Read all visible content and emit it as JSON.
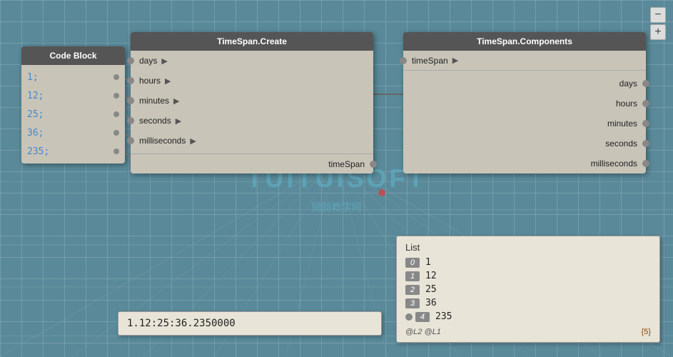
{
  "canvas": {
    "bg_color": "#5a8a9a"
  },
  "zoom_controls": {
    "minus_label": "−",
    "plus_label": "+"
  },
  "watermark": {
    "text": "TUITUISOFT",
    "sub": "腿腿教学网"
  },
  "code_block": {
    "title": "Code Block",
    "lines": [
      {
        "value": "1;"
      },
      {
        "value": "12;"
      },
      {
        "value": "25;"
      },
      {
        "value": "36;"
      },
      {
        "value": "235;"
      }
    ]
  },
  "timespan_create": {
    "title": "TimeSpan.Create",
    "inputs": [
      {
        "label": "days"
      },
      {
        "label": "hours"
      },
      {
        "label": "minutes"
      },
      {
        "label": "seconds"
      },
      {
        "label": "milliseconds"
      }
    ],
    "output_label": "timeSpan"
  },
  "timespan_components": {
    "title": "TimeSpan.Components",
    "input_label": "timeSpan",
    "outputs": [
      {
        "label": "days"
      },
      {
        "label": "hours"
      },
      {
        "label": "minutes"
      },
      {
        "label": "seconds"
      },
      {
        "label": "milliseconds"
      }
    ]
  },
  "output_panel": {
    "value": "1.12:25:36.2350000"
  },
  "list_panel": {
    "title": "List",
    "items": [
      {
        "index": "0",
        "value": "1"
      },
      {
        "index": "1",
        "value": "12"
      },
      {
        "index": "2",
        "value": "25"
      },
      {
        "index": "3",
        "value": "36"
      },
      {
        "index": "4",
        "value": "235"
      }
    ],
    "footer_left": "@L2 @L1",
    "footer_right": "{5}"
  }
}
